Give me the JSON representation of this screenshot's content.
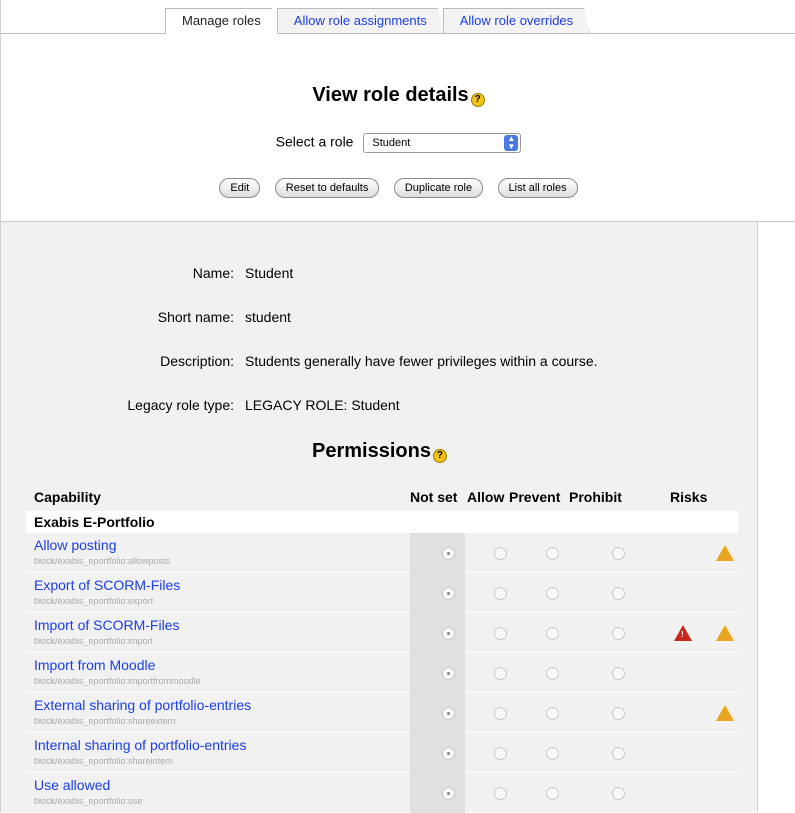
{
  "tabs": [
    {
      "label": "Manage roles",
      "active": true
    },
    {
      "label": "Allow role assignments",
      "active": false
    },
    {
      "label": "Allow role overrides",
      "active": false
    }
  ],
  "header": {
    "title": "View role details",
    "select_label": "Select a role",
    "selected_role": "Student"
  },
  "buttons": {
    "edit": "Edit",
    "reset": "Reset to defaults",
    "duplicate": "Duplicate role",
    "list_all": "List all roles"
  },
  "details": {
    "name_label": "Name:",
    "name_value": "Student",
    "short_label": "Short name:",
    "short_value": "student",
    "desc_label": "Description:",
    "desc_value": "Students generally have fewer privileges within a course.",
    "legacy_label": "Legacy role type:",
    "legacy_value": "LEGACY ROLE: Student"
  },
  "permissions": {
    "title": "Permissions",
    "columns": {
      "capability": "Capability",
      "not_set": "Not set",
      "allow": "Allow",
      "prevent": "Prevent",
      "prohibit": "Prohibit",
      "risks": "Risks"
    },
    "group": "Exabis E-Portfolio",
    "rows": [
      {
        "name": "Allow posting",
        "path": "block/exabis_eportfolio:allowposts",
        "selected": "not_set",
        "risk_danger": false,
        "risk_spam": true
      },
      {
        "name": "Export of SCORM-Files",
        "path": "block/exabis_eportfolio:export",
        "selected": "not_set",
        "risk_danger": false,
        "risk_spam": false
      },
      {
        "name": "Import of SCORM-Files",
        "path": "block/exabis_eportfolio:import",
        "selected": "not_set",
        "risk_danger": true,
        "risk_spam": true
      },
      {
        "name": "Import from Moodle",
        "path": "block/exabis_eportfolio:importfrommoodle",
        "selected": "not_set",
        "risk_danger": false,
        "risk_spam": false
      },
      {
        "name": "External sharing of portfolio-entries",
        "path": "block/exabis_eportfolio:shareextern",
        "selected": "not_set",
        "risk_danger": false,
        "risk_spam": true
      },
      {
        "name": "Internal sharing of portfolio-entries",
        "path": "block/exabis_eportfolio:shareintern",
        "selected": "not_set",
        "risk_danger": false,
        "risk_spam": false
      },
      {
        "name": "Use allowed",
        "path": "block/exabis_eportfolio:use",
        "selected": "not_set",
        "risk_danger": false,
        "risk_spam": false
      }
    ]
  },
  "colors": {
    "link": "#1a3ee8",
    "panel": "#f1f1f1",
    "risk_spam": "#e9a51e",
    "risk_danger": "#c8261a"
  },
  "icons": {
    "help": "help-icon",
    "risk_spam": "risk-spam-icon",
    "risk_danger": "risk-danger-icon"
  }
}
